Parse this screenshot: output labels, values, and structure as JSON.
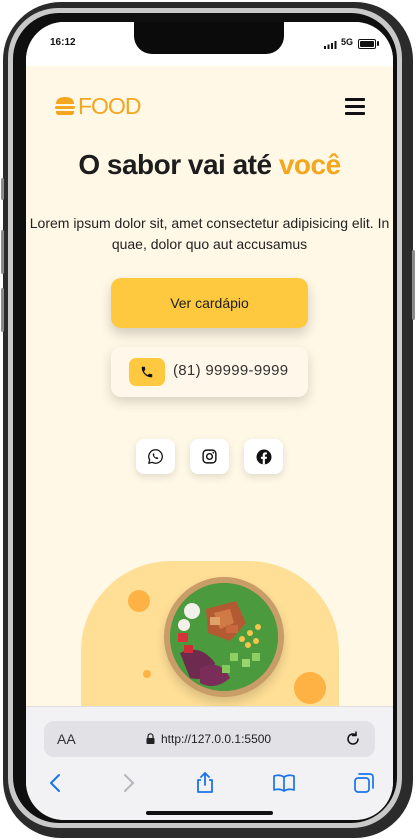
{
  "status_bar": {
    "time": "16:12",
    "network": "5G"
  },
  "header": {
    "logo_text": "FOOD"
  },
  "hero": {
    "title_main": "O sabor vai até ",
    "title_accent": "você",
    "description": "Lorem ipsum dolor sit, amet consectetur adipisicing elit. In quae, dolor quo aut accusamus",
    "menu_button_label": "Ver cardápio",
    "phone_number": "(81) 99999-9999"
  },
  "social": [
    {
      "icon": "whatsapp-icon"
    },
    {
      "icon": "instagram-icon"
    },
    {
      "icon": "facebook-icon"
    }
  ],
  "browser": {
    "text_size_label": "AA",
    "url": "http://127.0.0.1:5500"
  },
  "colors": {
    "accent": "#f4a61f",
    "button_yellow": "#ffc93f",
    "page_background": "#fff8e6",
    "blob": "#ffdf96"
  }
}
